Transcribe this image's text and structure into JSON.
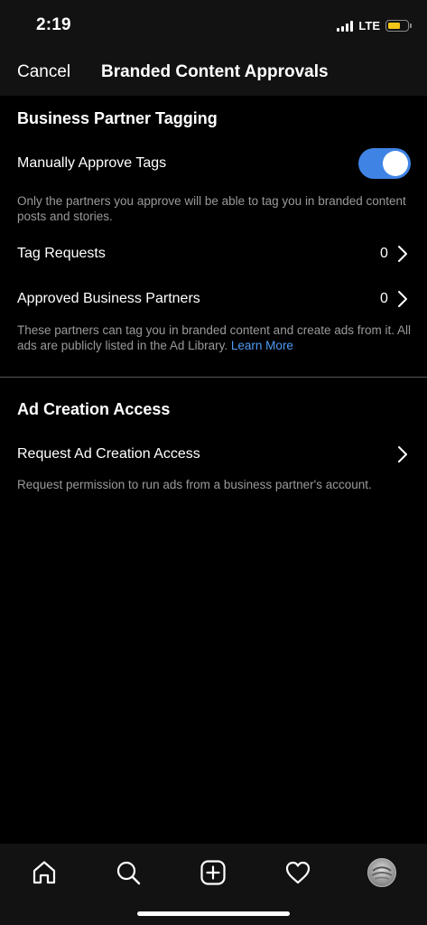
{
  "status_bar": {
    "time": "2:19",
    "network": "LTE",
    "battery_level": 0.65,
    "battery_color": "#f5c518"
  },
  "nav": {
    "cancel_label": "Cancel",
    "title": "Branded Content Approvals"
  },
  "business_partner_tagging": {
    "title": "Business Partner Tagging",
    "manual_approve": {
      "label": "Manually Approve Tags",
      "enabled": true
    },
    "manual_approve_desc": "Only the partners you approve will be able to tag you in branded content posts and stories.",
    "tag_requests": {
      "label": "Tag Requests",
      "count": "0"
    },
    "approved_partners": {
      "label": "Approved Business Partners",
      "count": "0"
    },
    "partners_desc": "These partners can tag you in branded content and create ads from it. All ads are publicly listed in the Ad Library.",
    "learn_more": "Learn More"
  },
  "ad_creation_access": {
    "title": "Ad Creation Access",
    "request": {
      "label": "Request Ad Creation Access"
    },
    "request_desc": "Request permission to run ads from a business partner's account."
  },
  "tab_bar": {
    "icons": [
      "home-icon",
      "search-icon",
      "new-post-icon",
      "activity-heart-icon",
      "profile-avatar"
    ]
  },
  "colors": {
    "accent": "#3f84e5",
    "link": "#4f9cf6",
    "secondary_text": "#9a9a9a"
  }
}
